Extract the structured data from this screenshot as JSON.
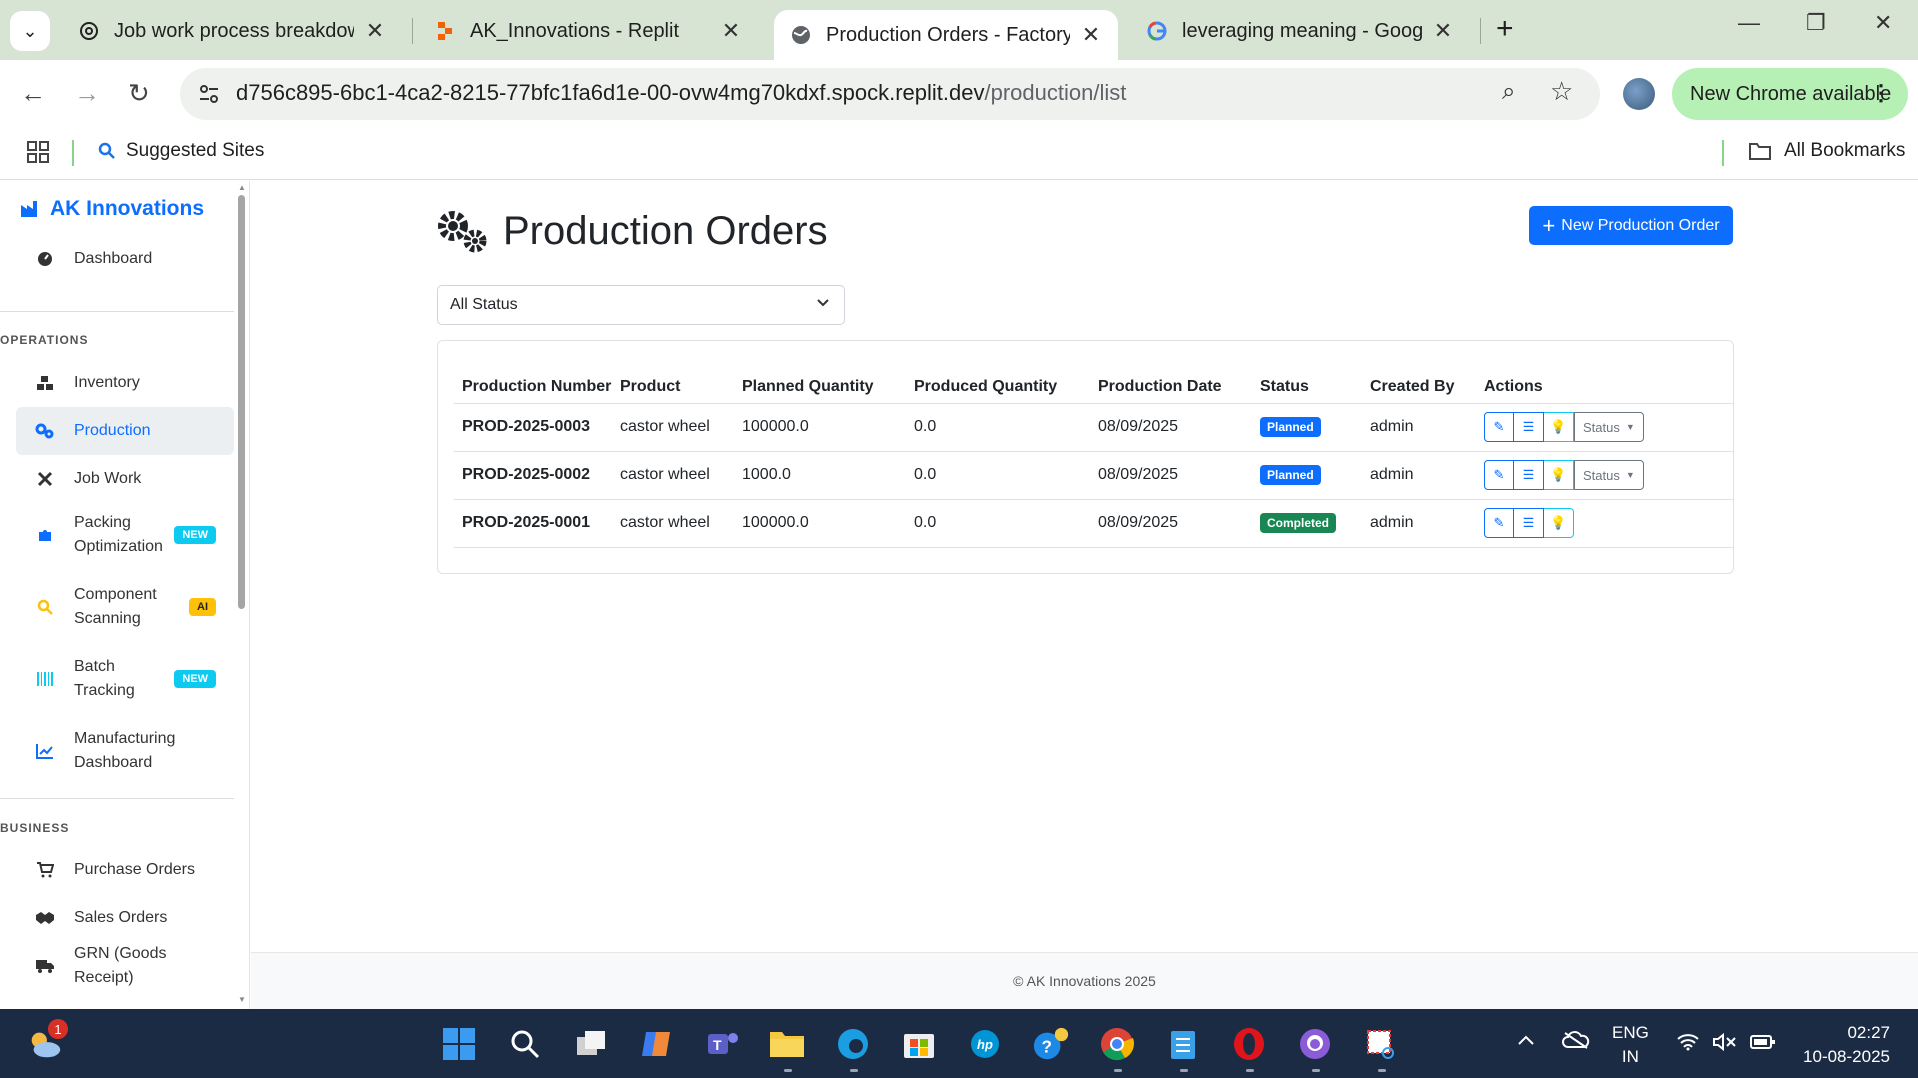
{
  "browser": {
    "tabs": [
      {
        "title": "Job work process breakdown",
        "favicon": "openai-icon"
      },
      {
        "title": "AK_Innovations - Replit",
        "favicon": "replit-icon"
      },
      {
        "title": "Production Orders - Factory Ma",
        "favicon": "globe-icon",
        "active": true
      },
      {
        "title": "leveraging meaning - Google S",
        "favicon": "google-icon"
      }
    ],
    "url_host": "d756c895-6bc1-4ca2-8215-77bfc1fa6d1e-00-ovw4mg70kdxf.spock.replit.dev",
    "url_path": "/production/list",
    "update_label": "New Chrome available",
    "bookmarks": {
      "suggested": "Suggested Sites",
      "all": "All Bookmarks"
    }
  },
  "sidebar": {
    "brand": "AK Innovations",
    "dashboard": "Dashboard",
    "section_operations": "OPERATIONS",
    "items_ops": [
      {
        "label": "Inventory",
        "icon": "boxes-icon"
      },
      {
        "label": "Production",
        "icon": "gears-icon",
        "active": true
      },
      {
        "label": "Job Work",
        "icon": "tools-icon"
      },
      {
        "label": "Packing Optimization",
        "icon": "puzzle-icon",
        "badge": "NEW"
      },
      {
        "label": "Component Scanning",
        "icon": "search-icon",
        "badge": "AI"
      },
      {
        "label": "Batch Tracking",
        "icon": "barcode-icon",
        "badge": "NEW"
      },
      {
        "label": "Manufacturing Dashboard",
        "icon": "chart-line-icon"
      }
    ],
    "section_business": "BUSINESS",
    "items_business": [
      {
        "label": "Purchase Orders",
        "icon": "cart-icon"
      },
      {
        "label": "Sales Orders",
        "icon": "handshake-icon"
      },
      {
        "label": "GRN (Goods Receipt)",
        "icon": "truck-icon"
      }
    ]
  },
  "main": {
    "title": "Production Orders",
    "new_button": "New Production Order",
    "filter_value": "All Status",
    "columns": [
      "Production Number",
      "Product",
      "Planned Quantity",
      "Produced Quantity",
      "Production Date",
      "Status",
      "Created By",
      "Actions"
    ],
    "rows": [
      {
        "number": "PROD-2025-0003",
        "product": "castor wheel",
        "planned": "100000.0",
        "produced": "0.0",
        "date": "08/09/2025",
        "status": "Planned",
        "created_by": "admin",
        "status_menu": "Status"
      },
      {
        "number": "PROD-2025-0002",
        "product": "castor wheel",
        "planned": "1000.0",
        "produced": "0.0",
        "date": "08/09/2025",
        "status": "Planned",
        "created_by": "admin",
        "status_menu": "Status"
      },
      {
        "number": "PROD-2025-0001",
        "product": "castor wheel",
        "planned": "100000.0",
        "produced": "0.0",
        "date": "08/09/2025",
        "status": "Completed",
        "created_by": "admin"
      }
    ],
    "footer": "© AK Innovations 2025"
  },
  "taskbar": {
    "weather_badge": "1",
    "lang_top": "ENG",
    "lang_bottom": "IN",
    "time": "02:27",
    "date": "10-08-2025"
  },
  "colors": {
    "primary": "#0d6efd",
    "planned": "#0d6efd",
    "completed": "#198754",
    "badge_new": "#0dcaf0",
    "badge_ai": "#ffc107"
  }
}
